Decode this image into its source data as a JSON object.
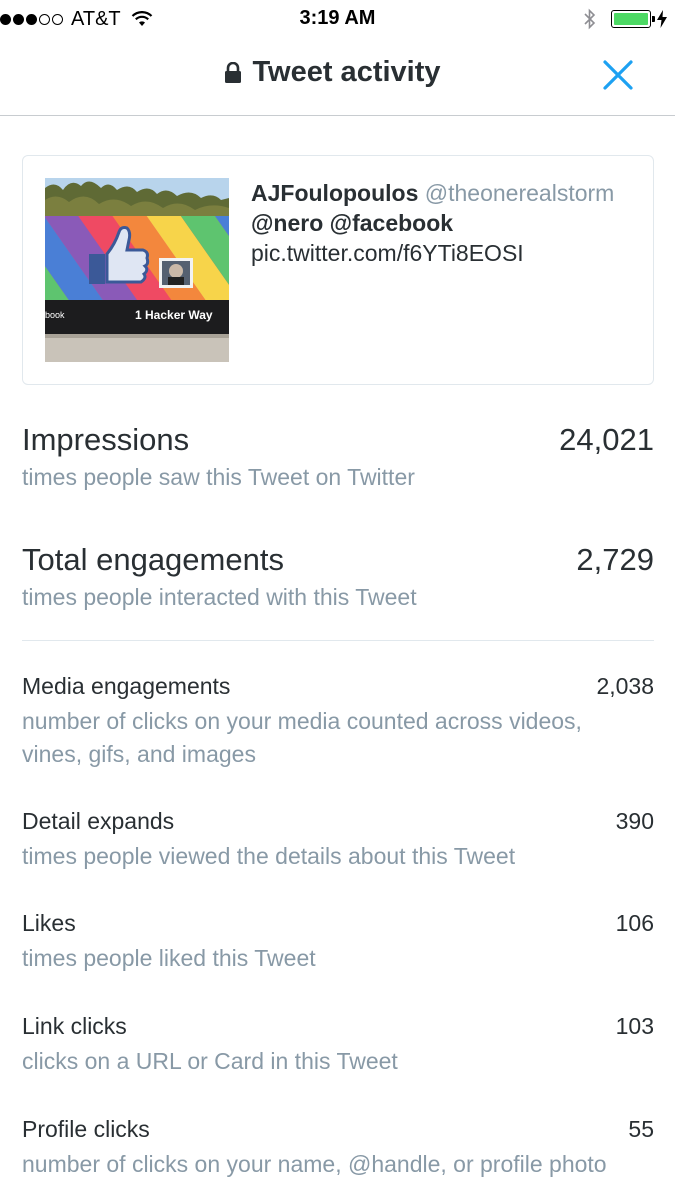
{
  "status_bar": {
    "carrier": "AT&T",
    "time": "3:19 AM",
    "signal_bars_filled": 3,
    "signal_bars_total": 5,
    "battery_level": 1.0,
    "battery_color": "#4cd964"
  },
  "nav": {
    "title": "Tweet activity",
    "close_icon": "close-icon",
    "accent_color": "#1da1f2"
  },
  "tweet": {
    "author_name": "AJFoulopoulos",
    "author_handle": "@theonerealstorm",
    "body_line1": "@nero @facebook",
    "link": "pic.twitter.com/f6YTi8EOSI",
    "media_sign_text": "1 Hacker Way",
    "media_sign_left_text": "book"
  },
  "stats": {
    "impressions": {
      "label": "Impressions",
      "value": "24,021",
      "desc": "times people saw this Tweet on Twitter"
    },
    "total_engagements": {
      "label": "Total engagements",
      "value": "2,729",
      "desc": "times people interacted with this Tweet"
    }
  },
  "metrics": [
    {
      "label": "Media engagements",
      "value": "2,038",
      "desc": "number of clicks on your media counted across videos, vines, gifs, and images"
    },
    {
      "label": "Detail expands",
      "value": "390",
      "desc": "times people viewed the details about this Tweet"
    },
    {
      "label": "Likes",
      "value": "106",
      "desc": "times people liked this Tweet"
    },
    {
      "label": "Link clicks",
      "value": "103",
      "desc": "clicks on a URL or Card in this Tweet"
    },
    {
      "label": "Profile clicks",
      "value": "55",
      "desc": "number of clicks on your name, @handle, or profile photo"
    }
  ]
}
